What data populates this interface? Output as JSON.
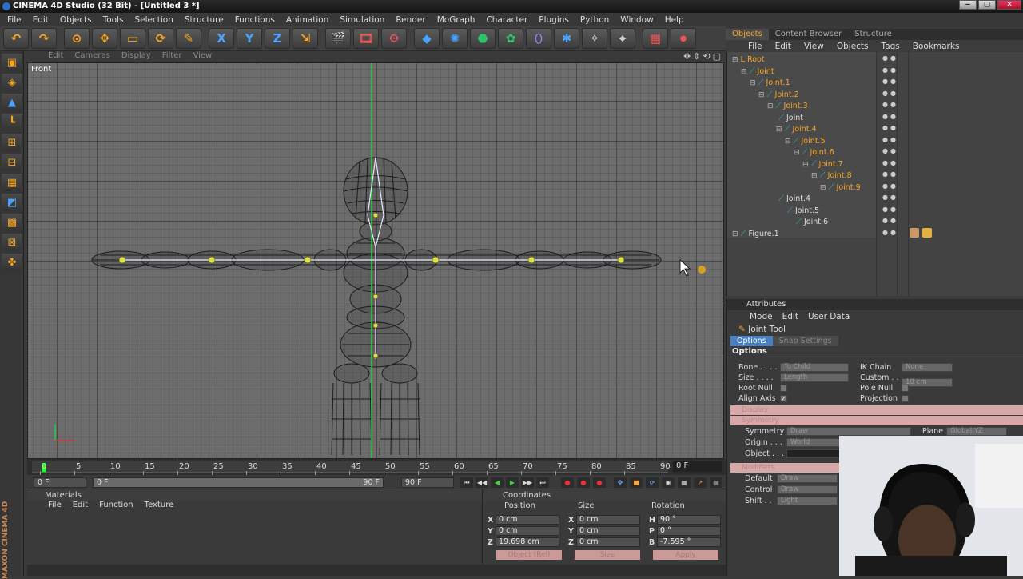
{
  "title_bar": "CINEMA 4D Studio (32 Bit) - [Untitled 3 *]",
  "menu": [
    "File",
    "Edit",
    "Objects",
    "Tools",
    "Selection",
    "Structure",
    "Functions",
    "Animation",
    "Simulation",
    "Render",
    "MoGraph",
    "Character",
    "Plugins",
    "Python",
    "Window",
    "Help"
  ],
  "toolbar_icons": [
    "undo-icon",
    "redo-icon",
    "live-selection-icon",
    "move-icon",
    "scale-icon",
    "rotate-icon",
    "joint-tool-icon",
    "x-axis-icon",
    "y-axis-icon",
    "z-axis-icon",
    "world-coords-icon",
    "render-view-icon",
    "render-picture-viewer-icon",
    "render-settings-icon",
    "cube-icon",
    "spline-icon",
    "nurbs-icon",
    "array-icon",
    "deformer-icon",
    "scene-icon",
    "light-icon",
    "camera-icon",
    "tag-icon",
    "record-icon"
  ],
  "toolbar_glyphs": [
    "↶",
    "↷",
    "⊙",
    "✥",
    "▭",
    "⟳",
    "✎",
    "X",
    "Y",
    "Z",
    "⇲",
    "🎬",
    "🎞",
    "⚙",
    "◆",
    "✺",
    "⬣",
    "✿",
    "⬯",
    "✱",
    "✧",
    "⌖",
    "▦",
    "⏺"
  ],
  "viewport": {
    "menu": [
      "Edit",
      "Cameras",
      "Display",
      "Filter",
      "View"
    ],
    "label": "Front"
  },
  "timeline": {
    "ticks": [
      "0",
      "5",
      "10",
      "15",
      "20",
      "25",
      "30",
      "35",
      "40",
      "45",
      "50",
      "55",
      "60",
      "65",
      "70",
      "75",
      "80",
      "85",
      "90"
    ],
    "end_frame": "0 F",
    "start_field": "0 F",
    "range_start": "0 F",
    "range_end": "90 F",
    "max_field": "90 F"
  },
  "materials": {
    "title": "Materials",
    "menu": [
      "File",
      "Edit",
      "Function",
      "Texture"
    ]
  },
  "coordinates": {
    "title": "Coordinates",
    "headers": [
      "Position",
      "Size",
      "Rotation"
    ],
    "rows": [
      {
        "a": "X",
        "pos": "0 cm",
        "sl": "X",
        "size": "0 cm",
        "rl": "H",
        "rot": "90 °"
      },
      {
        "a": "Y",
        "pos": "0 cm",
        "sl": "Y",
        "size": "0 cm",
        "rl": "P",
        "rot": "0 °"
      },
      {
        "a": "Z",
        "pos": "19.698 cm",
        "sl": "Z",
        "size": "0 cm",
        "rl": "B",
        "rot": "-7.595 °"
      }
    ],
    "mode_object": "Object (Rel)",
    "mode_size": "Size",
    "apply": "Apply"
  },
  "right_tabs": [
    "Objects",
    "Content Browser",
    "Structure"
  ],
  "object_manager": {
    "menu": [
      "File",
      "Edit",
      "View",
      "Objects",
      "Tags",
      "Bookmarks"
    ],
    "tree": [
      {
        "name": "Root",
        "d": 0,
        "o": 1
      },
      {
        "name": "Joint",
        "d": 1,
        "o": 1
      },
      {
        "name": "Joint.1",
        "d": 2,
        "o": 1
      },
      {
        "name": "Joint.2",
        "d": 3,
        "o": 1
      },
      {
        "name": "Joint.3",
        "d": 4,
        "o": 1
      },
      {
        "name": "Joint",
        "d": 5,
        "o": 0
      },
      {
        "name": "Joint.4",
        "d": 5,
        "o": 1
      },
      {
        "name": "Joint.5",
        "d": 6,
        "o": 1
      },
      {
        "name": "Joint.6",
        "d": 7,
        "o": 1
      },
      {
        "name": "Joint.7",
        "d": 8,
        "o": 1
      },
      {
        "name": "Joint.8",
        "d": 9,
        "o": 1
      },
      {
        "name": "Joint.9",
        "d": 10,
        "o": 1
      },
      {
        "name": "Joint.4",
        "d": 5,
        "o": 0
      },
      {
        "name": "Joint.5",
        "d": 6,
        "o": 0
      },
      {
        "name": "Joint.6",
        "d": 7,
        "o": 0
      },
      {
        "name": "Figure.1",
        "d": 0,
        "o": 0
      }
    ]
  },
  "attributes": {
    "title": "Attributes",
    "menu": [
      "Mode",
      "Edit",
      "User Data"
    ],
    "tool": "Joint Tool",
    "tabs": [
      "Options",
      "Snap Settings"
    ],
    "section": "Options",
    "bone_label": "Bone . . . .",
    "bone_val": "To Child",
    "size_label": "Size . . . .",
    "size_val": "Length",
    "root_null": "Root Null",
    "align_axis": "Align Axis",
    "align_check": "✓",
    "ik_chain": "IK Chain",
    "ik_val": "None",
    "custom": "Custom . . .",
    "custom_val": "10 cm",
    "pole_null": "Pole Null",
    "projection": "Projection",
    "display": "Display",
    "symmetry_grp": "Symmetry",
    "symmetry": "Symmetry",
    "sym_val": "Draw",
    "plane": "Plane",
    "plane_val": "Global YZ",
    "origin": "Origin . . .",
    "origin_val": "World",
    "object": "Object . . .",
    "modifiers": "Modifiers",
    "default": "Default",
    "default_val": "Draw",
    "control": "Control",
    "control_val": "Draw",
    "shift": "Shift . .",
    "shift_val": "Light"
  },
  "brand": "MAXON CINEMA 4D"
}
